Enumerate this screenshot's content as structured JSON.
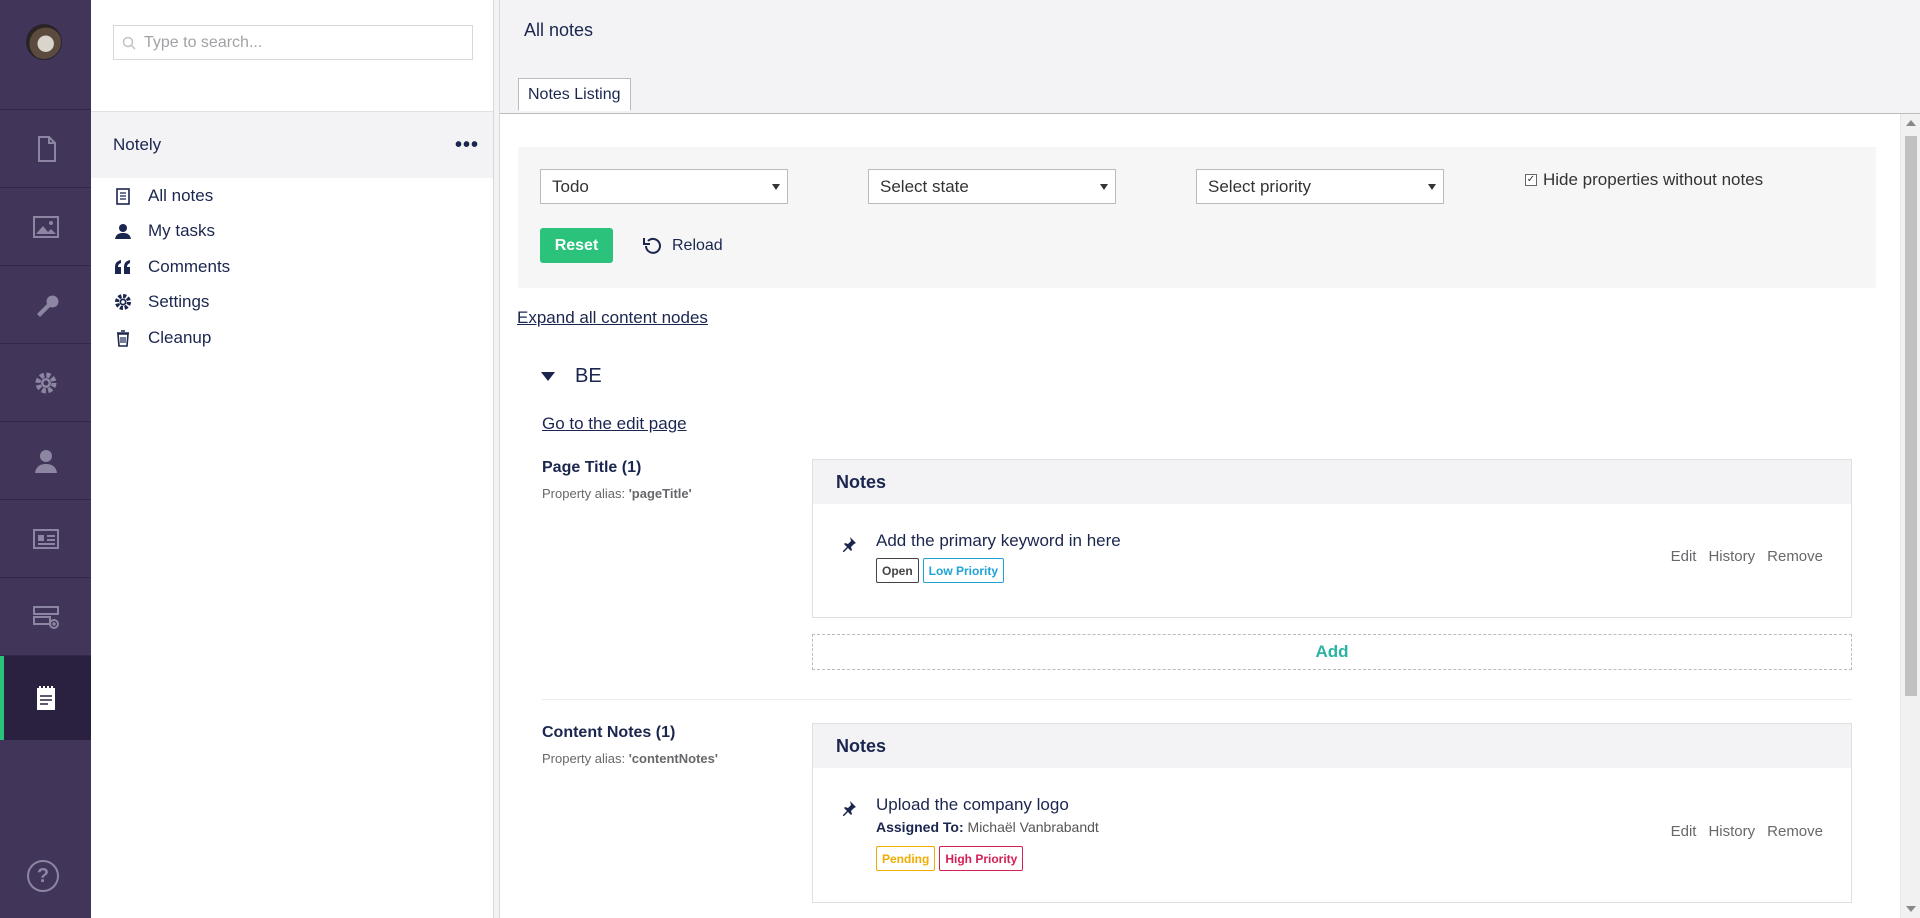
{
  "rail": {
    "sections": [
      {
        "name": "content-section",
        "icon": "document-icon"
      },
      {
        "name": "media-section",
        "icon": "image-icon"
      },
      {
        "name": "settings-section",
        "icon": "wrench-icon"
      },
      {
        "name": "packages-section",
        "icon": "gear-icon"
      },
      {
        "name": "users-section",
        "icon": "user-icon"
      },
      {
        "name": "members-section",
        "icon": "id-card-icon"
      },
      {
        "name": "forms-section",
        "icon": "server-add-icon"
      },
      {
        "name": "notely-section",
        "icon": "notepad-icon"
      }
    ],
    "help_label": "?"
  },
  "tree": {
    "search_placeholder": "Type to search...",
    "header_title": "Notely",
    "more_label": "•••",
    "items": [
      {
        "label": "All notes",
        "icon": "notebook-icon"
      },
      {
        "label": "My tasks",
        "icon": "user-icon"
      },
      {
        "label": "Comments",
        "icon": "quote-icon"
      },
      {
        "label": "Settings",
        "icon": "gear-icon"
      },
      {
        "label": "Cleanup",
        "icon": "trash-icon"
      }
    ]
  },
  "main": {
    "title": "All notes",
    "tab_label": "Notes Listing",
    "filters": {
      "type_value": "Todo",
      "state_placeholder": "Select state",
      "priority_placeholder": "Select priority",
      "hide_checkbox_label": "Hide properties without notes",
      "hide_checked": true,
      "reset_label": "Reset",
      "reload_label": "Reload"
    },
    "expand_label": "Expand all content nodes",
    "node": {
      "name": "BE",
      "edit_link": "Go to the edit page",
      "properties": [
        {
          "title": "Page Title (1)",
          "alias_prefix": "Property alias: ",
          "alias": "'pageTitle'",
          "notes_header": "Notes",
          "note": {
            "text": "Add the primary keyword in here",
            "tags": [
              {
                "label": "Open",
                "color": "#444444"
              },
              {
                "label": "Low Priority",
                "color": "#1fa3d6"
              }
            ],
            "actions": [
              "Edit",
              "History",
              "Remove"
            ]
          },
          "add_label": "Add"
        },
        {
          "title": "Content Notes (1)",
          "alias_prefix": "Property alias: ",
          "alias": "'contentNotes'",
          "notes_header": "Notes",
          "note": {
            "text": "Upload the company logo",
            "assigned_label": "Assigned To:",
            "assigned_to": "Michaël Vanbrabandt",
            "tags": [
              {
                "label": "Pending",
                "color": "#f0ac00"
              },
              {
                "label": "High Priority",
                "color": "#d42054"
              }
            ],
            "actions": [
              "Edit",
              "History",
              "Remove"
            ]
          }
        }
      ]
    }
  },
  "colors": {
    "rail_bg": "#413659",
    "accent_green": "#2bc37c",
    "add_teal": "#2bb3a4",
    "text_dark": "#1b264f"
  }
}
